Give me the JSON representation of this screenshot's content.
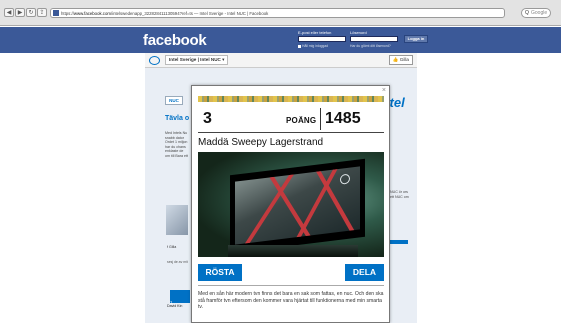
{
  "browser": {
    "url_host": "www.facebook.com",
    "url_path": "/intelswedenapp_322828411130594?ref=ts",
    "tab_title": "Intel Sverige - Intel NUC | Facebook",
    "search_placeholder": "Google"
  },
  "fb_header": {
    "logo": "facebook",
    "email_label": "E-post eller telefon",
    "password_label": "Lösenord",
    "login_button": "Logga in",
    "remember_label": "Håll mig inloggad",
    "forgot_label": "Har du glömt ditt lösenord?"
  },
  "app_bar": {
    "name": "Intel Sverige",
    "subname": "Intel NUC",
    "like_button": "Gilla"
  },
  "background_app": {
    "tab_label": "NUC",
    "heading": "Tävla o",
    "left_text": "Med Intels Nu snabb dator Ordet 1 miljon har du chans enklaste de om till Bara ett",
    "like_label": "Gilla",
    "small_text": "sesj de av mit",
    "banner_label": "1",
    "david_label": "David Kin",
    "right_text": "NUC ör ors ett NUC om",
    "intel_logo": "intel"
  },
  "modal": {
    "close_glyph": "×",
    "rank": "3",
    "points_label": "POÄNG",
    "points": "1485",
    "title": "Maddä Sweepy Lagerstrand",
    "vote_button": "RÖSTA",
    "share_button": "DELA",
    "description": "Med en sån här modern tvn finns det bara en sak som fattas, en nuc. Och den ska stå framför tvn eftersom den kommer vara hjärtat till funktionerna med min smarta tv."
  },
  "colors": {
    "facebook_blue": "#3b5998",
    "intel_blue": "#0071c5"
  }
}
